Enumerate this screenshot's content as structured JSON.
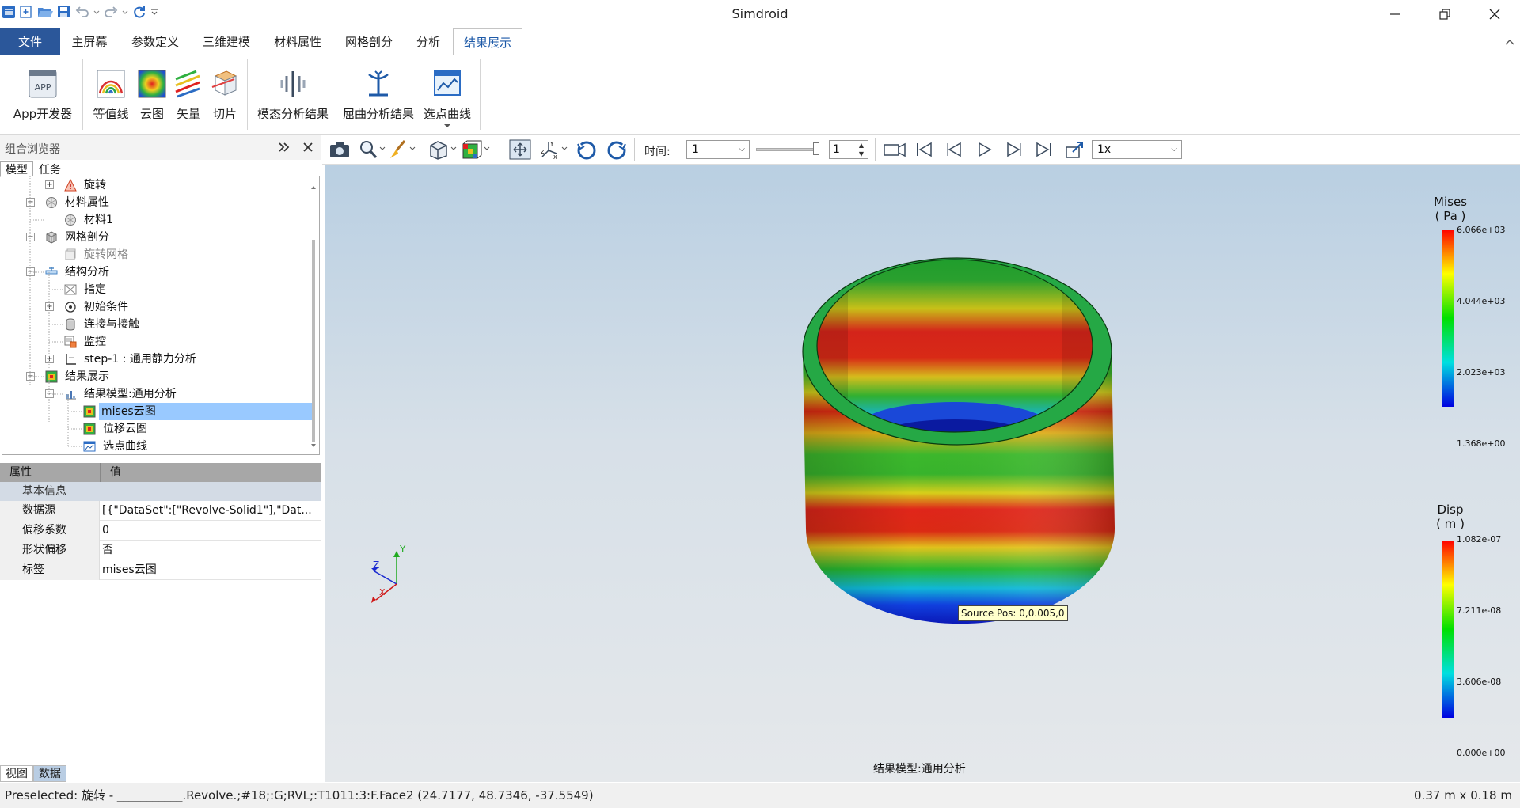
{
  "window": {
    "title": "Simdroid"
  },
  "menu": {
    "tabs": [
      "文件",
      "主屏幕",
      "参数定义",
      "三维建模",
      "材料属性",
      "网格剖分",
      "分析",
      "结果展示"
    ]
  },
  "ribbon": {
    "buttons": [
      "App开发器",
      "等值线",
      "云图",
      "矢量",
      "切片",
      "模态分析结果",
      "屈曲分析结果",
      "选点曲线"
    ]
  },
  "left_panel": {
    "title": "组合浏览器",
    "tabs": [
      "模型",
      "任务"
    ],
    "tree": [
      "旋转",
      "材料属性",
      "材料1",
      "网格剖分",
      "旋转网格",
      "结构分析",
      "指定",
      "初始条件",
      "连接与接触",
      "监控",
      "step-1 : 通用静力分析",
      "结果展示",
      "结果模型:通用分析",
      "mises云图",
      "位移云图",
      "选点曲线"
    ],
    "properties": {
      "headers": [
        "属性",
        "值"
      ],
      "group": "基本信息",
      "rows": [
        {
          "key": "数据源",
          "value": "[{\"DataSet\":[\"Revolve-Solid1\"],\"Dat..."
        },
        {
          "key": "偏移系数",
          "value": "0"
        },
        {
          "key": "形状偏移",
          "value": "否"
        },
        {
          "key": "标签",
          "value": "mises云图"
        }
      ]
    },
    "bottom_tabs": [
      "视图",
      "数据"
    ]
  },
  "view_toolbar": {
    "time_label": "时间:",
    "time_value": "1",
    "frame_value": "1",
    "speed_value": "1x"
  },
  "viewport": {
    "legend_mises": {
      "title_line1": "Mises",
      "title_line2": "( Pa )",
      "ticks": [
        "6.066e+03",
        "4.044e+03",
        "2.023e+03",
        "1.368e+00"
      ]
    },
    "legend_disp": {
      "title_line1": "Disp",
      "title_line2": "( m )",
      "ticks": [
        "1.082e-07",
        "7.211e-08",
        "3.606e-08",
        "0.000e+00"
      ]
    },
    "tooltip": "Source Pos: 0,0.005,0",
    "caption": "结果模型:通用分析",
    "axis_labels": {
      "x": "X",
      "y": "Y",
      "z": "Z"
    }
  },
  "status": {
    "left": "Preselected: 旋转 - ___________.Revolve.;#18;:G;RVL;:T1011:3:F.Face2 (24.7177, 48.7346, -37.5549)",
    "right": "0.37 m x 0.18 m"
  },
  "colors": {
    "file_tab": "#2b579a",
    "selection": "#99c9ff",
    "accent": "#1e5aa8"
  }
}
